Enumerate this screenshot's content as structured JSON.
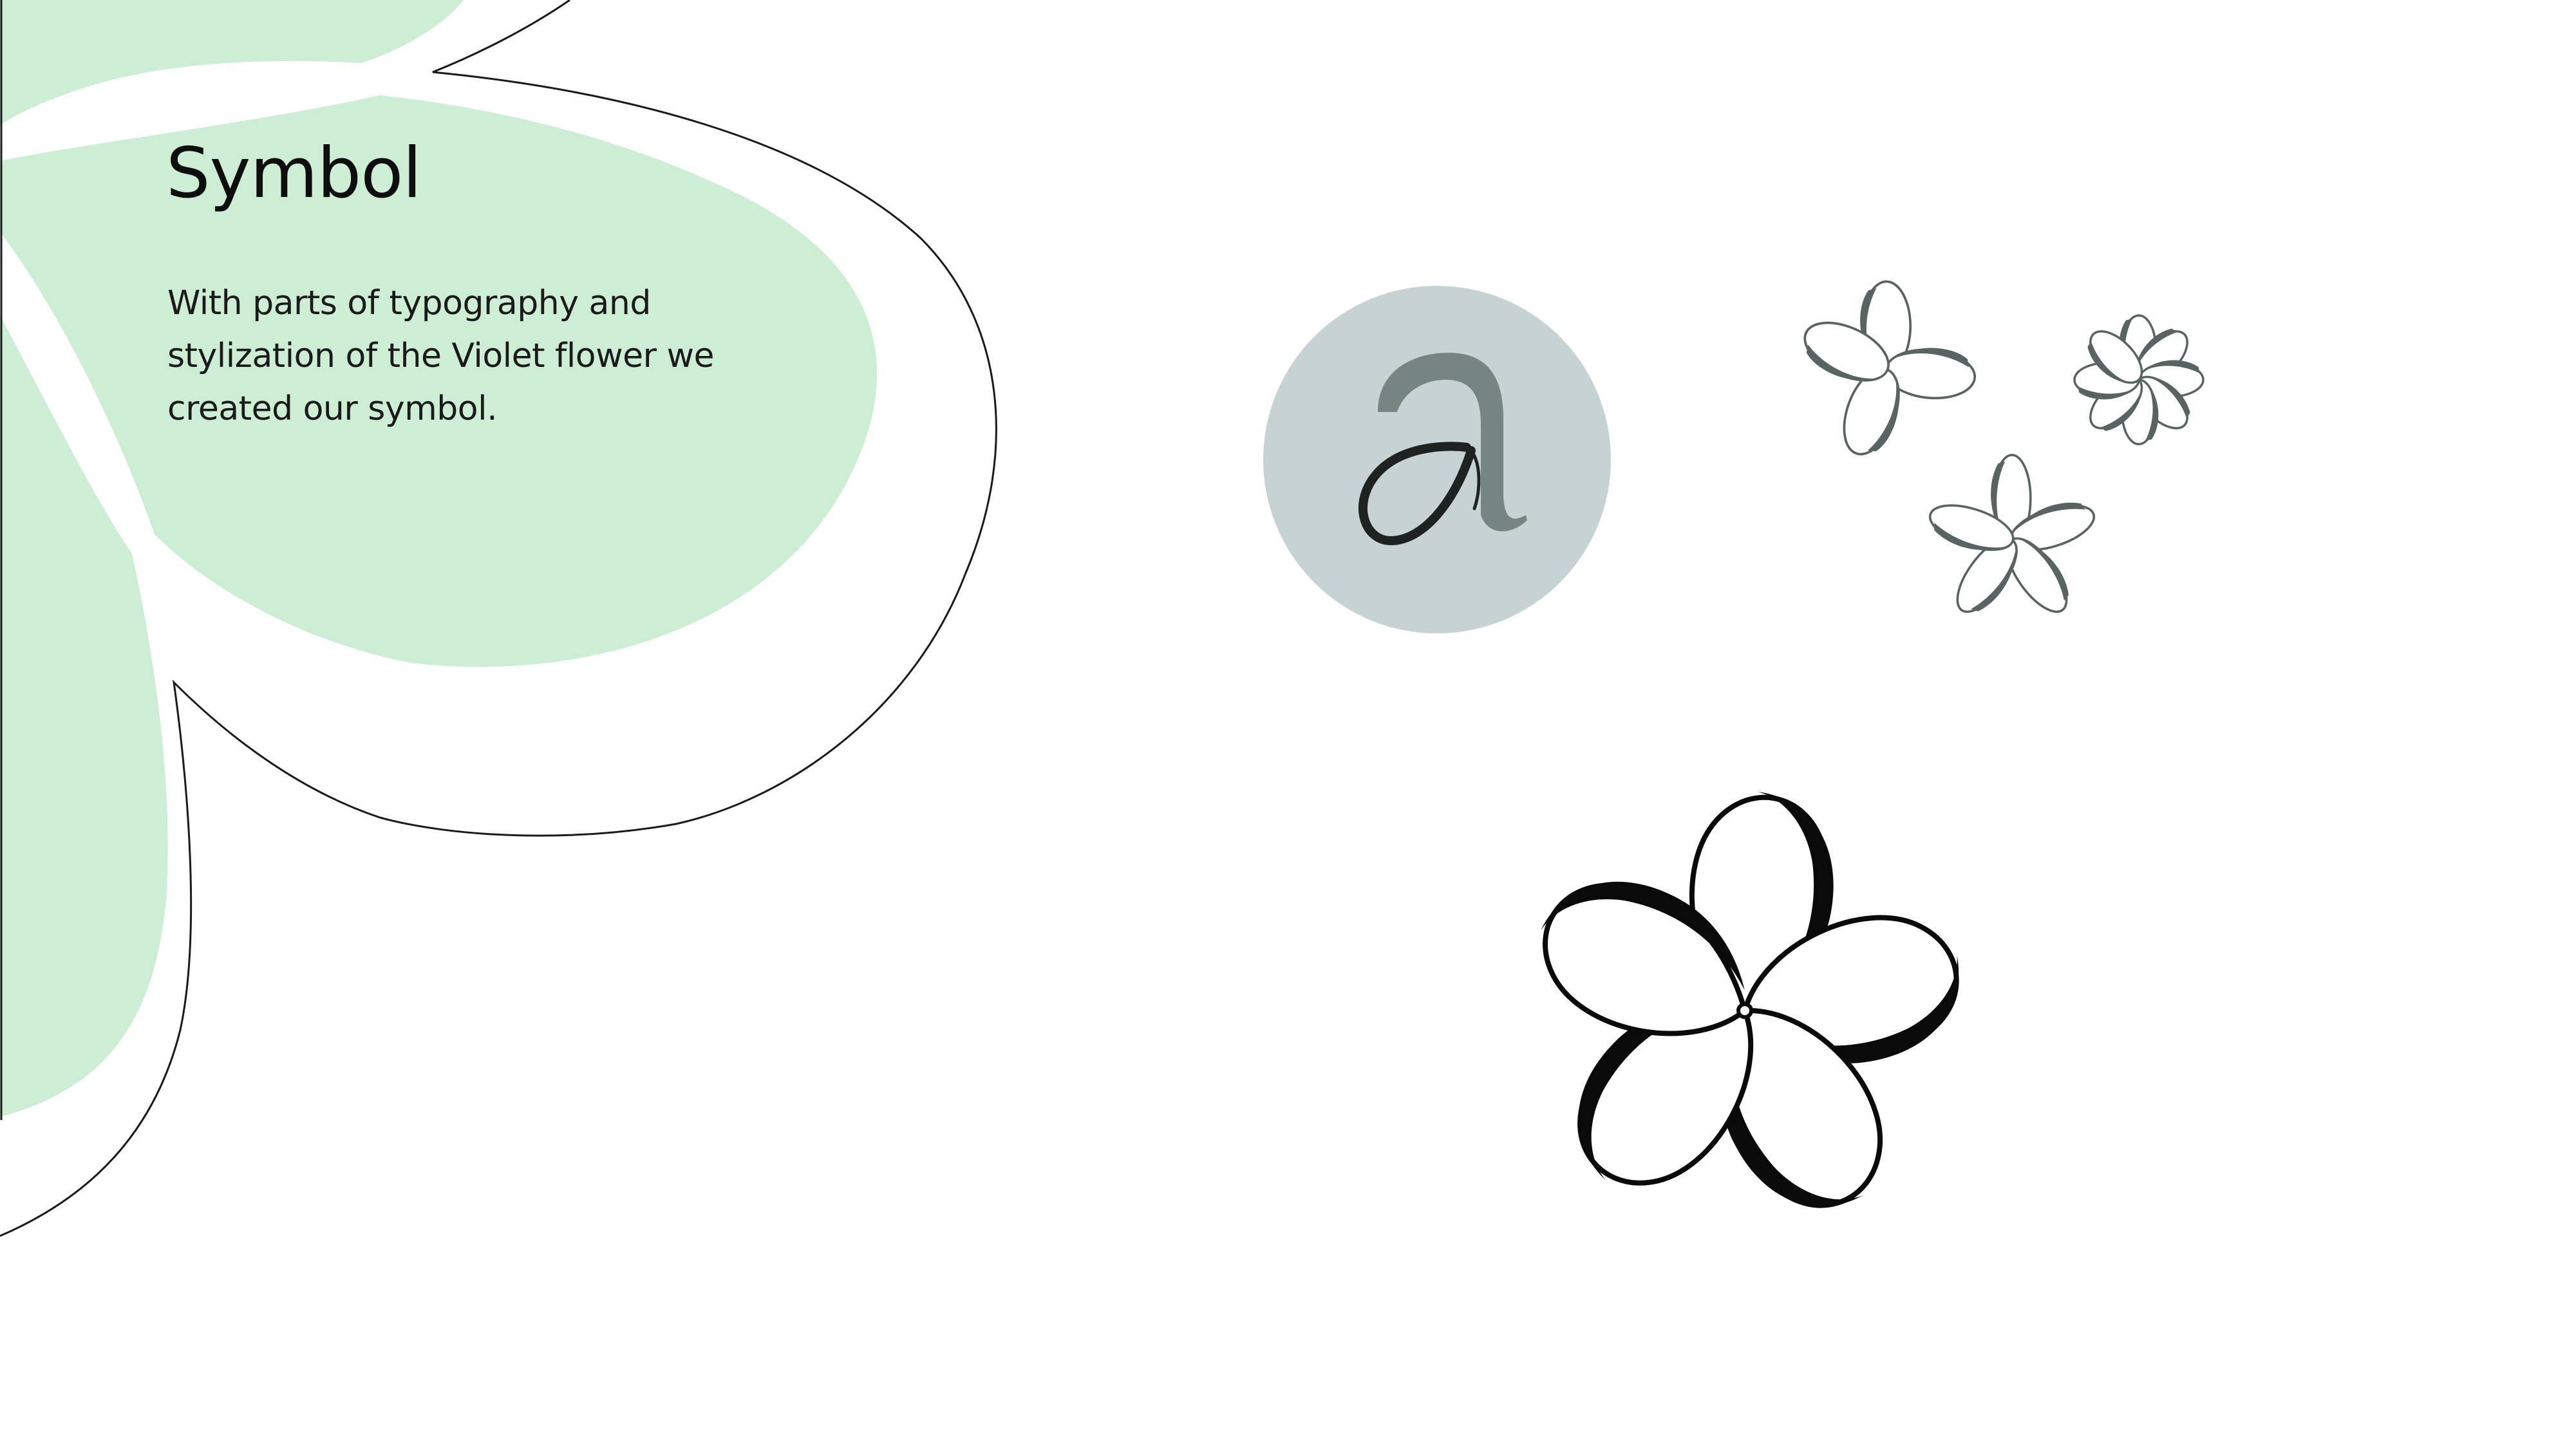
{
  "slide": {
    "title": "Symbol",
    "description_lines": [
      "With parts of typography and",
      "stylization of the Violet flower we",
      "created our symbol."
    ]
  },
  "symbol": {
    "letter": "a"
  },
  "colors": {
    "mint": "#cdeed4",
    "outline": "#1a1a1a",
    "circle": "#c7d3d2",
    "flower_gray": "#596462",
    "flower_black": "#0a0a0a",
    "background": "#ffffff"
  },
  "icons": {
    "decor_petals": "green-petal-shapes",
    "emblem": "letter-a-circle-icon",
    "small_flowers": "violet-flower-icons",
    "large_flower": "violet-flower-icon"
  }
}
